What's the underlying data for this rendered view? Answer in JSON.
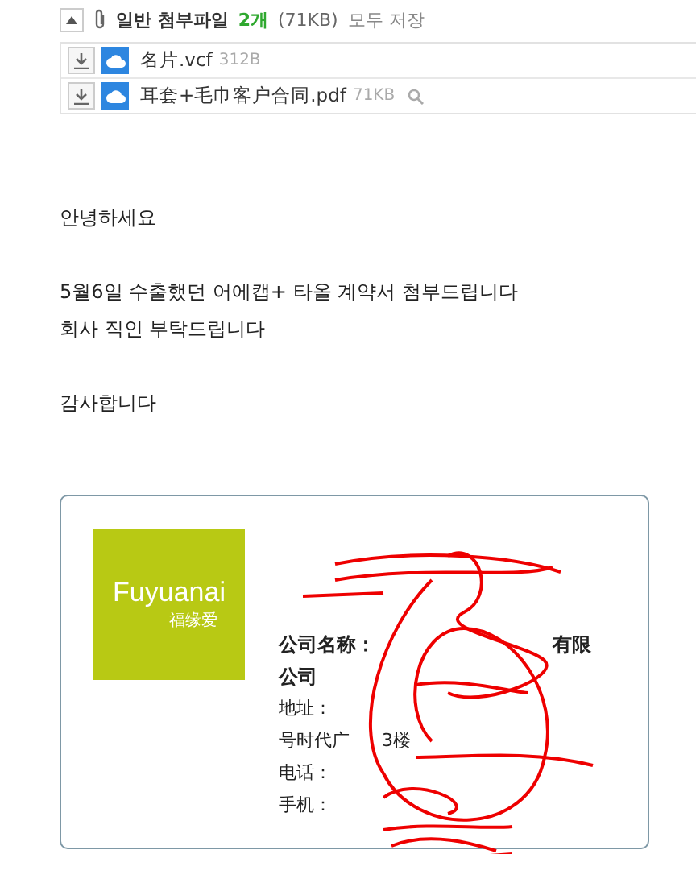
{
  "attachments": {
    "expanded": true,
    "title": "일반 첨부파일",
    "count": "2개",
    "total_size": "(71KB)",
    "save_all": "모두 저장",
    "files": [
      {
        "name": "名片.vcf",
        "size": "312B",
        "preview": false
      },
      {
        "name": "耳套+毛巾客户合同.pdf",
        "size": "71KB",
        "preview": true
      }
    ]
  },
  "body": {
    "paragraphs": [
      [
        "안녕하세요"
      ],
      [
        "5월6일 수출했던 어에캡+ 타올 계약서 첨부드립니다",
        "회사 직인 부탁드립니다"
      ],
      [
        "감사합니다"
      ]
    ]
  },
  "signature": {
    "logo": {
      "brand": "Fuyuanai",
      "subtitle": "福缘爱"
    },
    "company_label": "公司名称：",
    "company_tail": "有限",
    "company_line2": "公司",
    "address_label": "地址：",
    "address_line2": "号时代广",
    "address_tail": "3楼",
    "phone_label": "电话：",
    "mobile_label": "手机："
  }
}
